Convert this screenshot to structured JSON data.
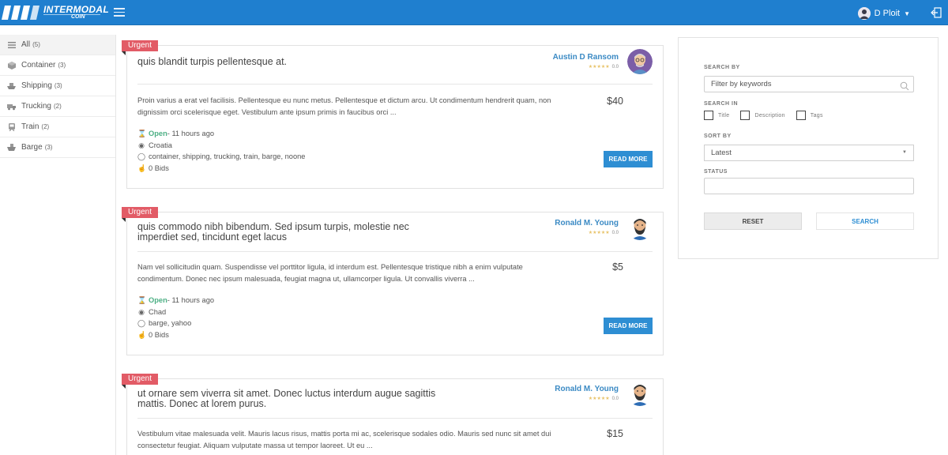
{
  "header": {
    "logo_text": "INTERMODAL",
    "logo_sub": "COIN",
    "user_name": "D Ploit"
  },
  "sidebar": {
    "items": [
      {
        "label": "All",
        "count": "(5)",
        "icon": "list-icon"
      },
      {
        "label": "Container",
        "count": "(3)",
        "icon": "box-icon"
      },
      {
        "label": "Shipping",
        "count": "(3)",
        "icon": "ship-icon"
      },
      {
        "label": "Trucking",
        "count": "(2)",
        "icon": "truck-icon"
      },
      {
        "label": "Train",
        "count": "(2)",
        "icon": "train-icon"
      },
      {
        "label": "Barge",
        "count": "(3)",
        "icon": "barge-icon"
      }
    ]
  },
  "listings": [
    {
      "badge": "Urgent",
      "title": "quis blandit turpis pellentesque at.",
      "author": "Austin D Ransom",
      "rating": "0.0",
      "price": "$40",
      "description": "Proin varius a erat vel facilisis. Pellentesque eu nunc metus. Pellentesque et dictum arcu. Ut condimentum hendrerit quam, non dignissim orci scelerisque eget. Vestibulum ante ipsum primis in faucibus orci ...",
      "status": "Open",
      "time": " - 11 hours ago",
      "location": "Croatia",
      "tags": "container, shipping, trucking, train, barge, noone",
      "bids": "0 Bids",
      "button": "READ MORE"
    },
    {
      "badge": "Urgent",
      "title": "quis commodo nibh bibendum. Sed ipsum turpis, molestie nec imperdiet sed, tincidunt eget lacus",
      "author": "Ronald  M. Young",
      "rating": "0.0",
      "price": "$5",
      "description": "Nam vel sollicitudin quam. Suspendisse vel porttitor ligula, id interdum est. Pellentesque tristique nibh a enim vulputate condimentum. Donec nec ipsum malesuada, feugiat magna ut, ullamcorper ligula. Ut convallis viverra ...",
      "status": "Open",
      "time": " - 11 hours ago",
      "location": "Chad",
      "tags": "barge, yahoo",
      "bids": "0 Bids",
      "button": "READ MORE"
    },
    {
      "badge": "Urgent",
      "title": "ut ornare sem viverra sit amet. Donec luctus interdum augue sagittis mattis. Donec at lorem purus.",
      "author": "Ronald  M. Young",
      "rating": "0.0",
      "price": "$15",
      "description": "Vestibulum vitae malesuada velit. Mauris lacus risus, mattis porta mi ac, scelerisque sodales odio. Mauris sed nunc sit amet dui consectetur feugiat. Aliquam vulputate massa ut tempor laoreet. Ut eu ..."
    }
  ],
  "search_panel": {
    "search_by_label": "SEARCH BY",
    "keywords_placeholder": "Filter by keywords",
    "search_in_label": "SEARCH IN",
    "search_in_options": [
      "Title",
      "Description",
      "Tags"
    ],
    "sort_by_label": "SORT BY",
    "sort_value": "Latest",
    "status_label": "STATUS",
    "status_value": "",
    "reset_label": "RESET",
    "search_label": "SEARCH"
  },
  "colors": {
    "header": "#1f7fcf",
    "urgent": "#e25b66",
    "accent": "#2e8ed3",
    "open": "#4caf84"
  }
}
